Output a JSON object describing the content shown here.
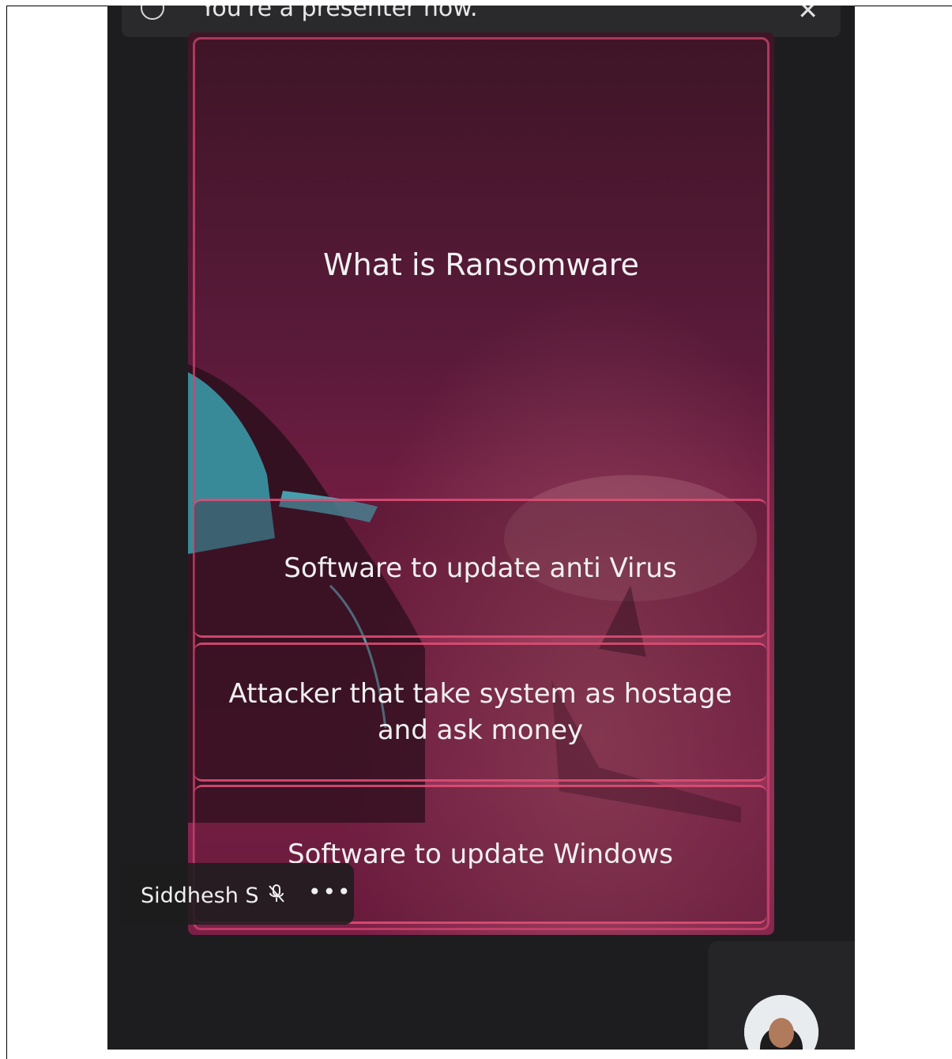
{
  "banner": {
    "text": "You're a presenter now.",
    "close_icon": "close-icon",
    "info_icon": "presenter-icon"
  },
  "slide": {
    "question": "What is Ransomware",
    "options": [
      "Software to update anti Virus",
      "Attacker that take system as hostage and ask money",
      "Software to update Windows"
    ]
  },
  "participant": {
    "name": "Siddhesh S",
    "mic_icon": "mic-off-icon",
    "more_icon": "more-options-icon"
  },
  "self_view": {
    "avatar_icon": "avatar"
  }
}
